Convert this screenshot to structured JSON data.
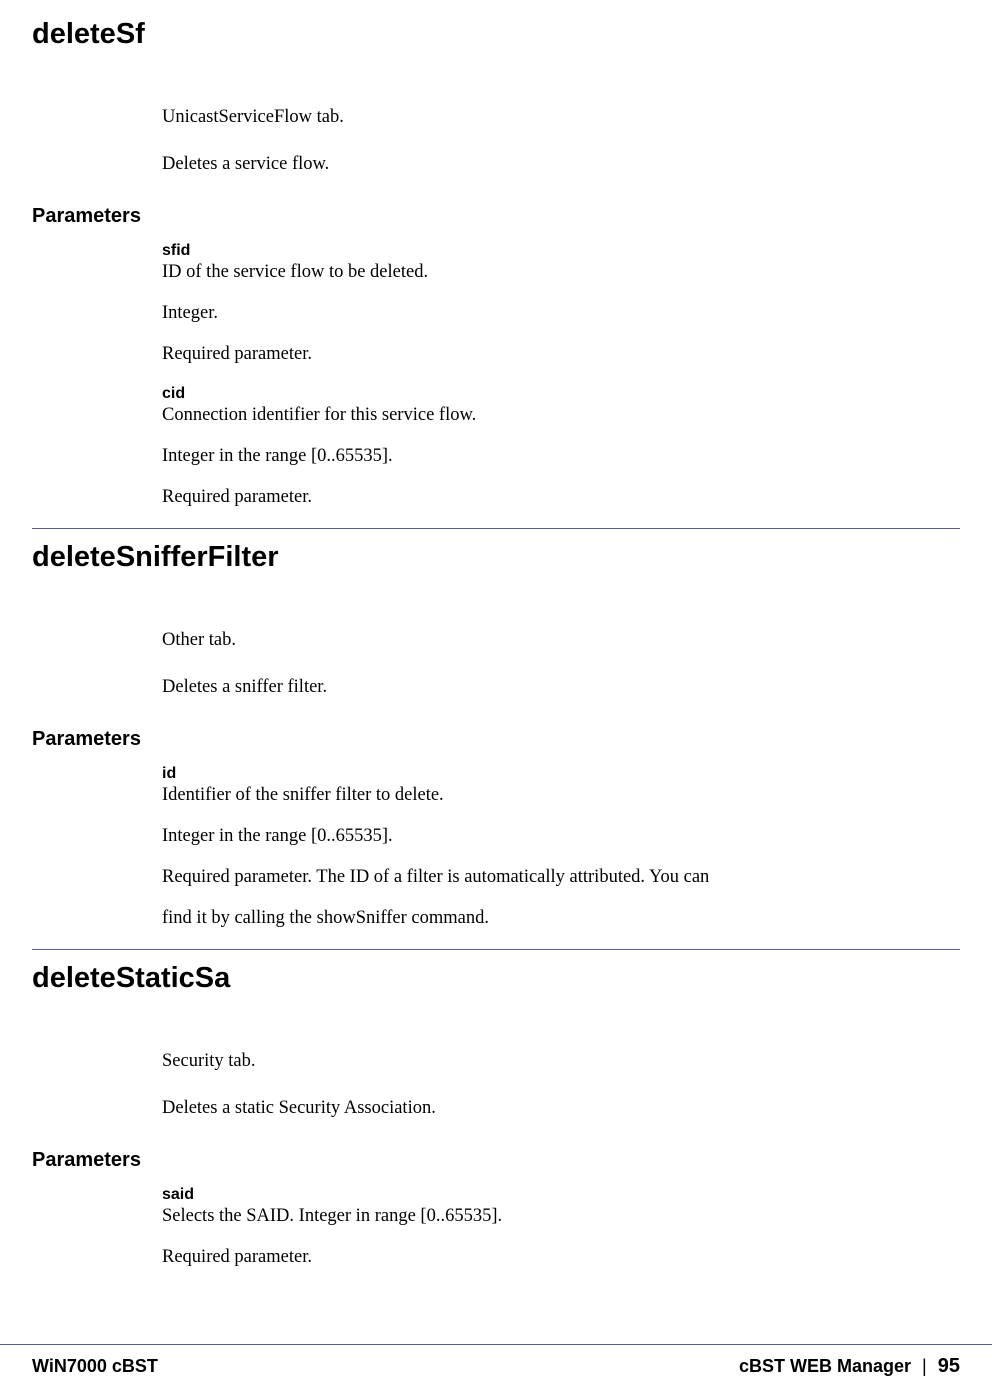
{
  "sections": [
    {
      "title": "deleteSf",
      "intro": [
        "UnicastServiceFlow tab.",
        "Deletes a service flow."
      ],
      "params_label": "Parameters",
      "params": [
        {
          "name": "sfid",
          "lines": [
            "ID of the service flow to be deleted.",
            "Integer.",
            "Required parameter."
          ]
        },
        {
          "name": "cid",
          "lines": [
            "Connection identifier for this service flow.",
            "Integer in the range [0..65535].",
            "Required parameter."
          ]
        }
      ]
    },
    {
      "title": "deleteSnifferFilter",
      "intro": [
        "Other tab.",
        "Deletes a sniffer filter."
      ],
      "params_label": "Parameters",
      "params": [
        {
          "name": "id",
          "lines": [
            "Identifier of the sniffer filter to delete.",
            "Integer in the range [0..65535].",
            "Required parameter. The ID of a filter is automatically attributed. You can",
            "find it by calling the showSniffer command."
          ]
        }
      ]
    },
    {
      "title": "deleteStaticSa",
      "intro": [
        "Security tab.",
        "Deletes a static Security Association."
      ],
      "params_label": "Parameters",
      "params": [
        {
          "name": "said",
          "lines": [
            "Selects the SAID. Integer in range [0..65535].",
            "Required parameter."
          ]
        }
      ]
    }
  ],
  "footer": {
    "left": "WiN7000 cBST",
    "right_label": "cBST WEB Manager",
    "separator": "|",
    "page_number": "95"
  }
}
